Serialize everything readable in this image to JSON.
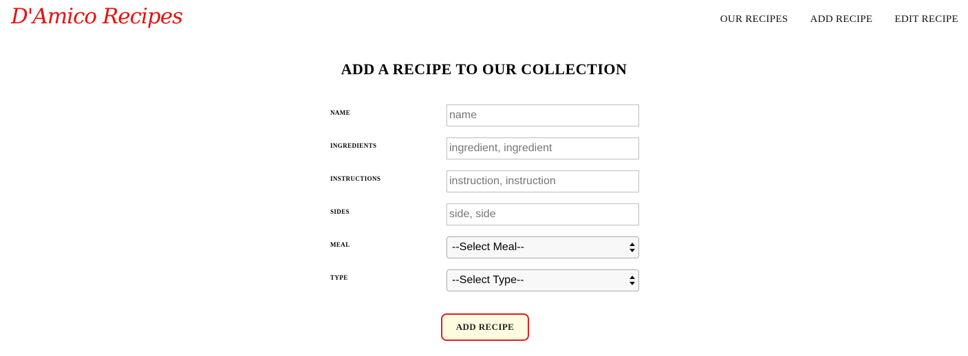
{
  "header": {
    "logo": "D'Amico Recipes",
    "nav": [
      "OUR RECIPES",
      "ADD RECIPE",
      "EDIT RECIPE"
    ]
  },
  "form": {
    "title": "ADD A RECIPE TO OUR COLLECTION",
    "fields": {
      "name": {
        "label": "NAME",
        "placeholder": "name",
        "value": ""
      },
      "ingredients": {
        "label": "INGREDIENTS",
        "placeholder": "ingredient, ingredient",
        "value": ""
      },
      "instructions": {
        "label": "INSTRUCTIONS",
        "placeholder": "instruction, instruction",
        "value": ""
      },
      "sides": {
        "label": "SIDES",
        "placeholder": "side, side",
        "value": ""
      },
      "meal": {
        "label": "MEAL",
        "selected": "--Select Meal--"
      },
      "type": {
        "label": "TYPE",
        "selected": "--Select Type--"
      }
    },
    "submit_label": "ADD RECIPE"
  },
  "colors": {
    "logo": "#e8110f",
    "button_border": "#e01e1e",
    "button_bg": "#fffbe0"
  }
}
